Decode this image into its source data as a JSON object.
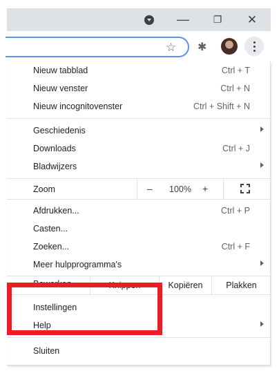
{
  "window": {
    "minimize_glyph": "—",
    "restore_glyph": "❐",
    "close_glyph": "✕"
  },
  "toolbar": {
    "star_glyph": "☆",
    "extensions_glyph": "✱"
  },
  "menu": {
    "group1": [
      {
        "label": "Nieuw tabblad",
        "shortcut": "Ctrl + T"
      },
      {
        "label": "Nieuw venster",
        "shortcut": "Ctrl + N"
      },
      {
        "label": "Nieuw incognitovenster",
        "shortcut": "Ctrl + Shift + N"
      }
    ],
    "group2": [
      {
        "label": "Geschiedenis",
        "shortcut": ""
      },
      {
        "label": "Downloads",
        "shortcut": "Ctrl + J"
      },
      {
        "label": "Bladwijzers",
        "shortcut": ""
      }
    ],
    "zoom": {
      "label": "Zoom",
      "minus": "–",
      "value": "100%",
      "plus": "+"
    },
    "group3": [
      {
        "label": "Afdrukken...",
        "shortcut": "Ctrl + P"
      },
      {
        "label": "Casten...",
        "shortcut": ""
      },
      {
        "label": "Zoeken...",
        "shortcut": "Ctrl + F"
      },
      {
        "label": "Meer hulpprogramma's",
        "shortcut": ""
      }
    ],
    "edit": {
      "label": "Bewerken",
      "cut": "Knippen",
      "copy": "Kopiëren",
      "paste": "Plakken"
    },
    "group4": [
      {
        "label": "Instellingen",
        "shortcut": ""
      },
      {
        "label": "Help",
        "shortcut": ""
      }
    ],
    "exit": {
      "label": "Sluiten"
    }
  },
  "colors": {
    "highlight": "#ee1c24",
    "titlebar": "#dee1e6",
    "omnibox_border": "#5b8fe8"
  }
}
